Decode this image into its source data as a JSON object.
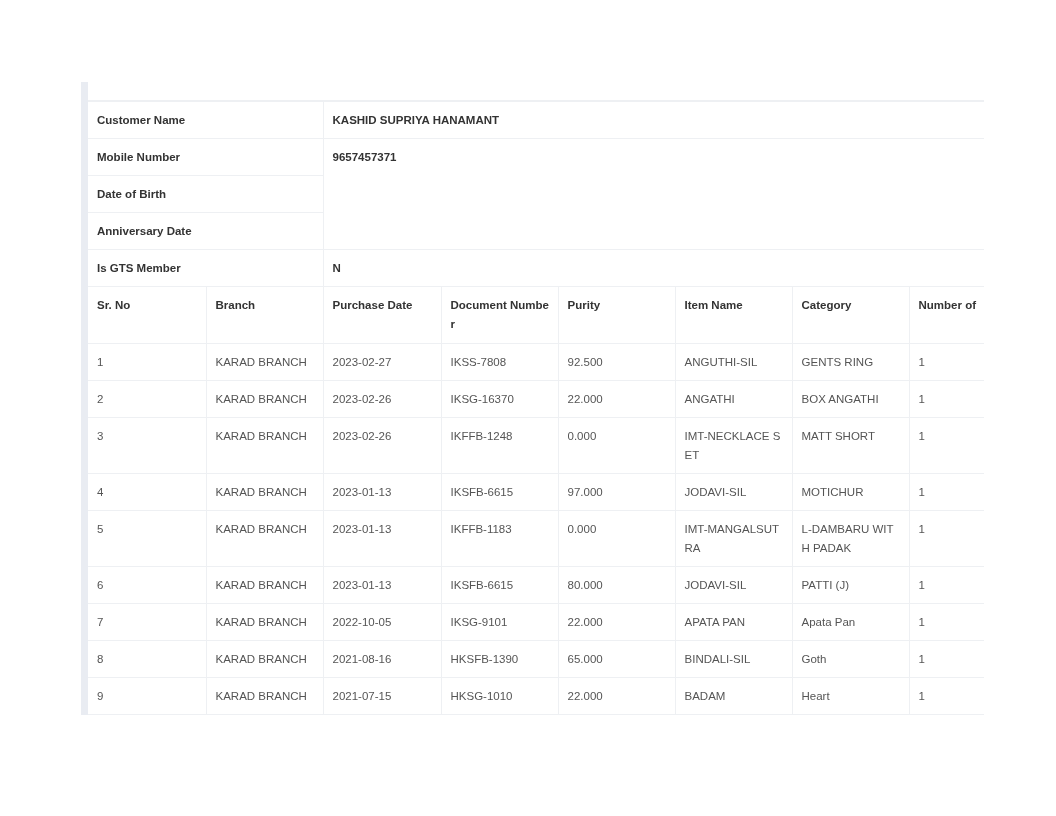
{
  "customer": [
    {
      "label": "Customer Name",
      "value": "KASHID SUPRIYA HANAMANT"
    },
    {
      "label": "Mobile Number",
      "value": "9657457371"
    },
    {
      "label": "Date of Birth"
    },
    {
      "label": "Anniversary Date"
    },
    {
      "label": "Is GTS Member",
      "value": "N"
    }
  ],
  "table": {
    "columns": [
      "Sr. No",
      "Branch",
      "Purchase Date",
      "Document Number",
      "Purity",
      "Item Name",
      "Category",
      "Number of"
    ],
    "rows": [
      [
        "1",
        "KARAD BRANCH",
        "2023-02-27",
        "IKSS-7808",
        "92.500",
        "ANGUTHI-SIL",
        "GENTS RING",
        "1"
      ],
      [
        "2",
        "KARAD BRANCH",
        "2023-02-26",
        "IKSG-16370",
        "22.000",
        "ANGATHI",
        "BOX ANGATHI",
        "1"
      ],
      [
        "3",
        "KARAD BRANCH",
        "2023-02-26",
        "IKFFB-1248",
        "0.000",
        "IMT-NECKLACE SET",
        "MATT SHORT",
        "1"
      ],
      [
        "4",
        "KARAD BRANCH",
        "2023-01-13",
        "IKSFB-6615",
        "97.000",
        "JODAVI-SIL",
        "MOTICHUR",
        "1"
      ],
      [
        "5",
        "KARAD BRANCH",
        "2023-01-13",
        "IKFFB-1183",
        "0.000",
        "IMT-MANGALSUTRA",
        "L-DAMBARU WITH PADAK",
        "1"
      ],
      [
        "6",
        "KARAD BRANCH",
        "2023-01-13",
        "IKSFB-6615",
        "80.000",
        "JODAVI-SIL",
        "PATTI (J)",
        "1"
      ],
      [
        "7",
        "KARAD BRANCH",
        "2022-10-05",
        "IKSG-9101",
        "22.000",
        "APATA PAN",
        "Apata Pan",
        "1"
      ],
      [
        "8",
        "KARAD BRANCH",
        "2021-08-16",
        "HKSFB-1390",
        "65.000",
        "BINDALI-SIL",
        "Goth",
        "1"
      ],
      [
        "9",
        "KARAD BRANCH",
        "2021-07-15",
        "HKSG-1010",
        "22.000",
        "BADAM",
        "Heart",
        "1"
      ]
    ]
  }
}
